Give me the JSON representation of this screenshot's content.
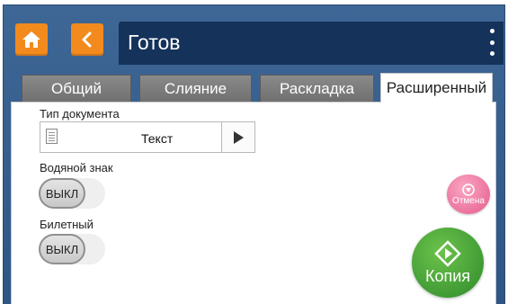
{
  "header": {
    "title": "Готов",
    "home_icon": "home-icon",
    "back_icon": "chevron-left-icon",
    "menu_icon": "more-vertical-icon"
  },
  "tabs": [
    {
      "label": "Общий",
      "active": false
    },
    {
      "label": "Слияние",
      "active": false
    },
    {
      "label": "Раскладка",
      "active": false
    },
    {
      "label": "Расширенный",
      "active": true
    }
  ],
  "settings": {
    "doc_type": {
      "label": "Тип документа",
      "value": "Текст"
    },
    "watermark": {
      "label": "Водяной знак",
      "state": "ВЫКЛ"
    },
    "ticket": {
      "label": "Билетный",
      "state": "ВЫКЛ"
    }
  },
  "actions": {
    "cancel_label": "Отмена",
    "copy_label": "Копия"
  },
  "colors": {
    "accent_orange": "#f28a1e",
    "header_dark": "#14325a",
    "frame_blue": "#3e6796",
    "cancel_pink": "#e65a8d",
    "copy_green": "#2e8b2c"
  }
}
